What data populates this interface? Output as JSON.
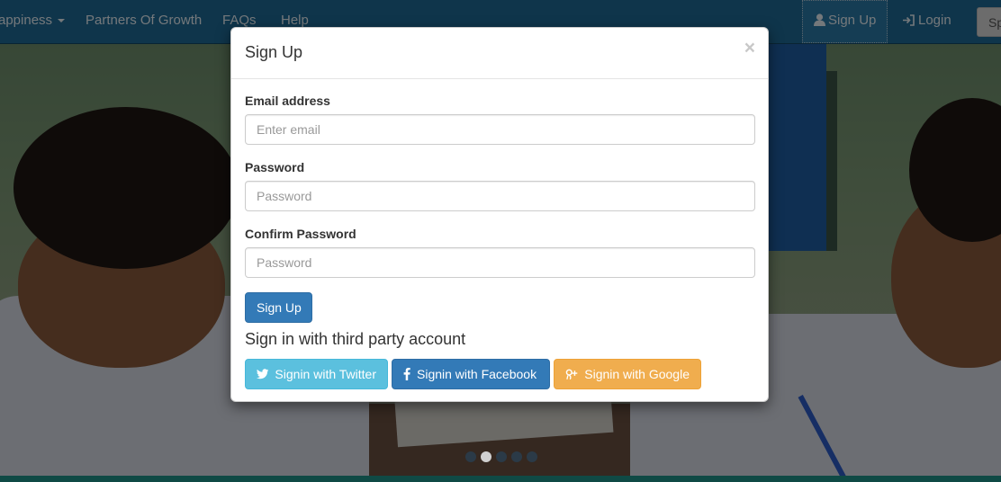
{
  "navbar": {
    "items": [
      {
        "label": "appiness",
        "has_caret": true
      },
      {
        "label": "Partners Of Growth"
      },
      {
        "label": "FAQs"
      },
      {
        "label": "Help"
      }
    ],
    "signup_label": "Sign Up",
    "login_label": "Login",
    "cut_button_label": "Sp"
  },
  "carousel": {
    "slide_count": 5,
    "active_index": 1
  },
  "modal": {
    "title": "Sign Up",
    "close_glyph": "×",
    "email": {
      "label": "Email address",
      "placeholder": "Enter email",
      "value": ""
    },
    "password": {
      "label": "Password",
      "placeholder": "Password",
      "value": ""
    },
    "confirm_password": {
      "label": "Confirm Password",
      "placeholder": "Password",
      "value": ""
    },
    "submit_label": "Sign Up",
    "third_party_heading": "Sign in with third party account",
    "social": {
      "twitter": {
        "label": "Signin with Twitter",
        "icon": "twitter-icon",
        "color": "#5bc0de"
      },
      "facebook": {
        "label": "Signin with Facebook",
        "icon": "facebook-icon",
        "color": "#337ab7"
      },
      "google": {
        "label": "Signin with Google",
        "icon": "google-plus-icon",
        "color": "#f0ad4e"
      }
    }
  },
  "colors": {
    "navbar": "#1e6a96",
    "primary": "#337ab7",
    "overlay": "rgba(0,0,0,0.5)"
  }
}
